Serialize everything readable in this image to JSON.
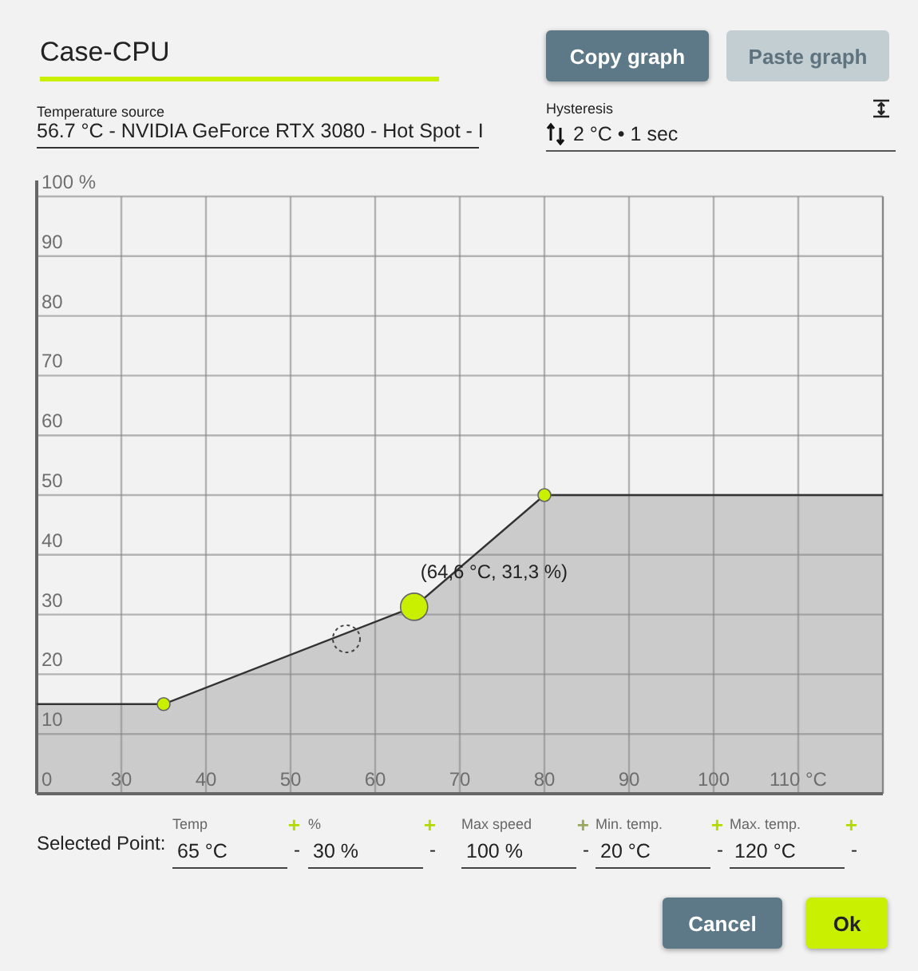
{
  "name_field": {
    "value": "Case-CPU"
  },
  "buttons": [
    {
      "label": "Copy graph",
      "disabled": false
    },
    {
      "label": "Paste graph",
      "disabled": true
    }
  ],
  "temperature_source": {
    "label": "Temperature source",
    "value": "56.7 °C - NVIDIA GeForce RTX 3080 - Hot Spot - I"
  },
  "hysteresis": {
    "label": "Hysteresis",
    "value": "2 °C • 1 sec"
  },
  "chart_data": {
    "type": "area",
    "x": [
      20,
      35,
      64.6,
      80,
      120
    ],
    "series": [
      {
        "color": "#cacbca",
        "values": [
          15,
          15,
          31.3,
          50,
          50
        ]
      }
    ],
    "grid": true,
    "xlim": [
      20,
      120
    ],
    "ylim": [
      0,
      100
    ],
    "xticks": [
      30,
      40,
      50,
      60,
      70,
      80,
      90,
      100,
      {
        "value": 110,
        "label": "110 °C"
      }
    ],
    "yticks": [
      {
        "value": 0,
        "label": "0"
      },
      10,
      20,
      30,
      40,
      50,
      60,
      70,
      80,
      90,
      {
        "value": 100,
        "label": "100 %"
      }
    ],
    "annotations": [
      {
        "x": 64.6,
        "y": 31.3,
        "text": "(64,6 °C, 31,3 %)"
      }
    ]
  },
  "selected_point": {
    "label": "Selected Point:",
    "fields": [
      {
        "label": "Temp",
        "value": "65 °C",
        "plus": "+",
        "minus": "-",
        "plus_disabled": false
      },
      {
        "label": "%",
        "value": "30 %",
        "plus": "+",
        "minus": "-",
        "plus_disabled": false
      },
      {
        "label": "Max speed",
        "value": "100 %",
        "plus": "+",
        "minus": "-",
        "plus_disabled": true
      },
      {
        "label": "Min. temp.",
        "value": "20 °C",
        "plus": "+",
        "minus": "-",
        "plus_disabled": false
      },
      {
        "label": "Max. temp.",
        "value": "120 °C",
        "plus": "+",
        "minus": "-",
        "plus_disabled": false
      }
    ]
  },
  "actions": [
    {
      "label": "Cancel",
      "kind": "secondary"
    },
    {
      "label": "Ok",
      "kind": "primary"
    }
  ]
}
